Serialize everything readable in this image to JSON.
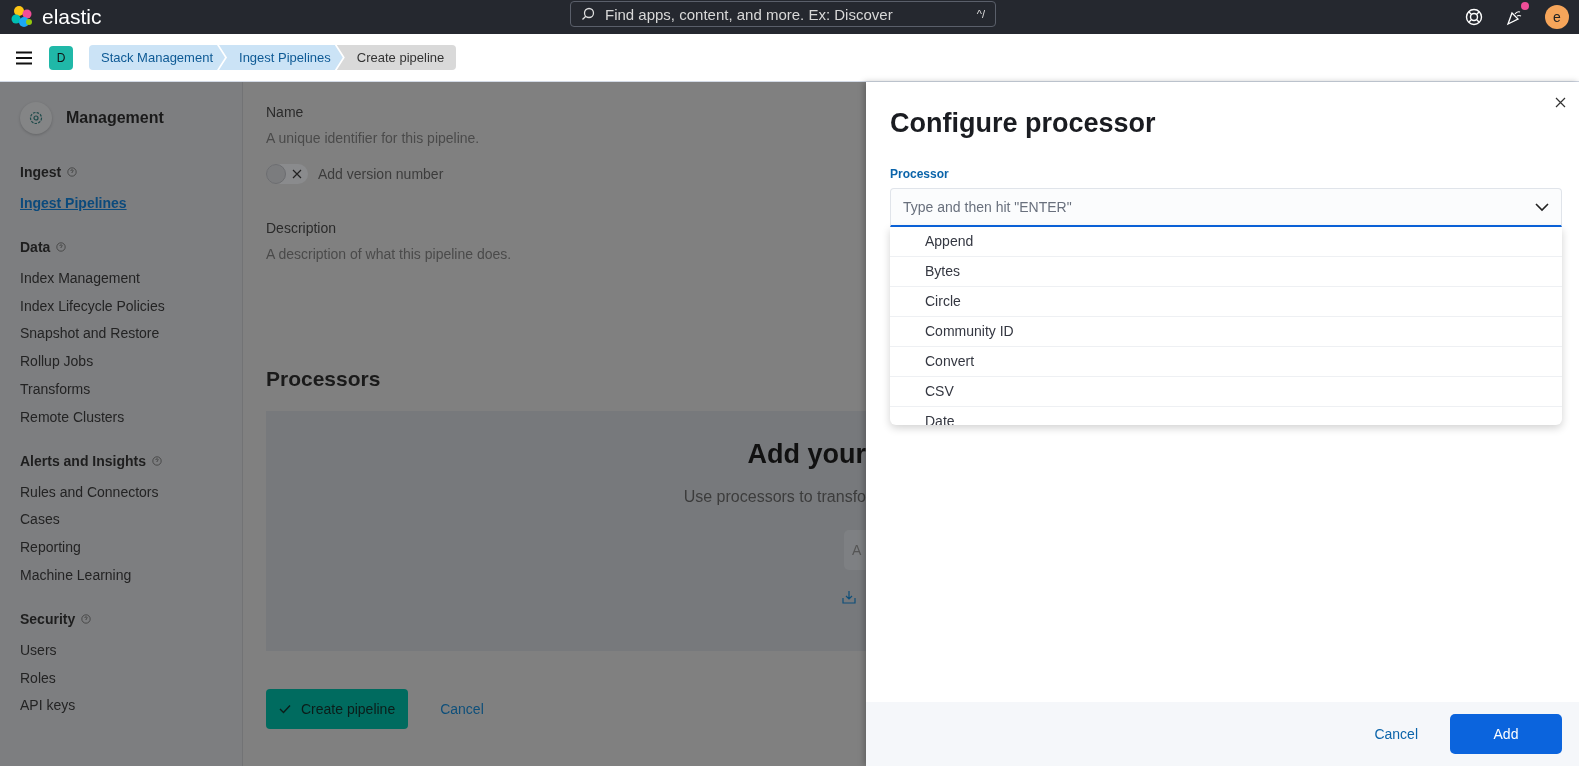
{
  "header": {
    "brand": "elastic",
    "search": {
      "placeholder": "Find apps, content, and more. Ex: Discover",
      "shortcut": "^/"
    },
    "avatar": "e",
    "news_unread": true
  },
  "nav": {
    "space": "D",
    "breadcrumbs": [
      {
        "label": "Stack Management",
        "current": false
      },
      {
        "label": "Ingest Pipelines",
        "current": false
      },
      {
        "label": "Create pipeline",
        "current": true
      }
    ]
  },
  "sidebar": {
    "title": "Management",
    "sections": [
      {
        "title": "Ingest",
        "items": [
          {
            "label": "Ingest Pipelines",
            "selected": true
          }
        ]
      },
      {
        "title": "Data",
        "items": [
          {
            "label": "Index Management",
            "selected": false
          },
          {
            "label": "Index Lifecycle Policies",
            "selected": false
          },
          {
            "label": "Snapshot and Restore",
            "selected": false
          },
          {
            "label": "Rollup Jobs",
            "selected": false
          },
          {
            "label": "Transforms",
            "selected": false
          },
          {
            "label": "Remote Clusters",
            "selected": false
          }
        ]
      },
      {
        "title": "Alerts and Insights",
        "items": [
          {
            "label": "Rules and Connectors",
            "selected": false
          },
          {
            "label": "Cases",
            "selected": false
          },
          {
            "label": "Reporting",
            "selected": false
          },
          {
            "label": "Machine Learning",
            "selected": false
          }
        ]
      },
      {
        "title": "Security",
        "items": [
          {
            "label": "Users",
            "selected": false
          },
          {
            "label": "Roles",
            "selected": false
          },
          {
            "label": "API keys",
            "selected": false
          }
        ]
      }
    ]
  },
  "form": {
    "name": {
      "label": "Name",
      "help": "A unique identifier for this pipeline."
    },
    "version_toggle": {
      "label": "Add version number",
      "on": false
    },
    "description": {
      "label": "Description",
      "help": "A description of what this pipeline does."
    },
    "processors": {
      "title": "Processors",
      "empty_title": "Add your",
      "empty_text": "Use processors to transfo",
      "button": "A"
    },
    "buttons": {
      "create": "Create pipeline",
      "cancel": "Cancel"
    }
  },
  "flyout": {
    "title": "Configure processor",
    "field_label": "Processor",
    "placeholder": "Type and then hit \"ENTER\"",
    "options": [
      "Append",
      "Bytes",
      "Circle",
      "Community ID",
      "Convert",
      "CSV",
      "Date"
    ],
    "buttons": {
      "cancel": "Cancel",
      "add": "Add"
    }
  }
}
